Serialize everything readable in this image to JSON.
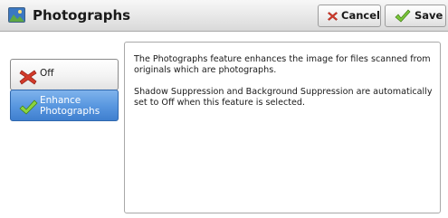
{
  "header": {
    "title": "Photographs",
    "title_icon": "photo-icon",
    "cancel_label": "Cancel",
    "cancel_icon": "red-x-icon",
    "save_label": "Save",
    "save_icon": "green-check-icon"
  },
  "options": [
    {
      "label": "Off",
      "icon": "red-x-icon",
      "selected": false
    },
    {
      "label_lines": [
        "Enhance",
        "Photographs"
      ],
      "icon": "green-check-icon",
      "selected": true
    }
  ],
  "description": {
    "paragraph1": "The Photographs feature enhances the image for files scanned from originals which are photographs.",
    "paragraph2": "Shadow Suppression and Background Suppression are automatically set to Off when this feature is selected."
  },
  "colors": {
    "selected_option": "#5a98e0",
    "cancel_icon": "#d23a2a",
    "save_icon": "#6ab32e"
  }
}
